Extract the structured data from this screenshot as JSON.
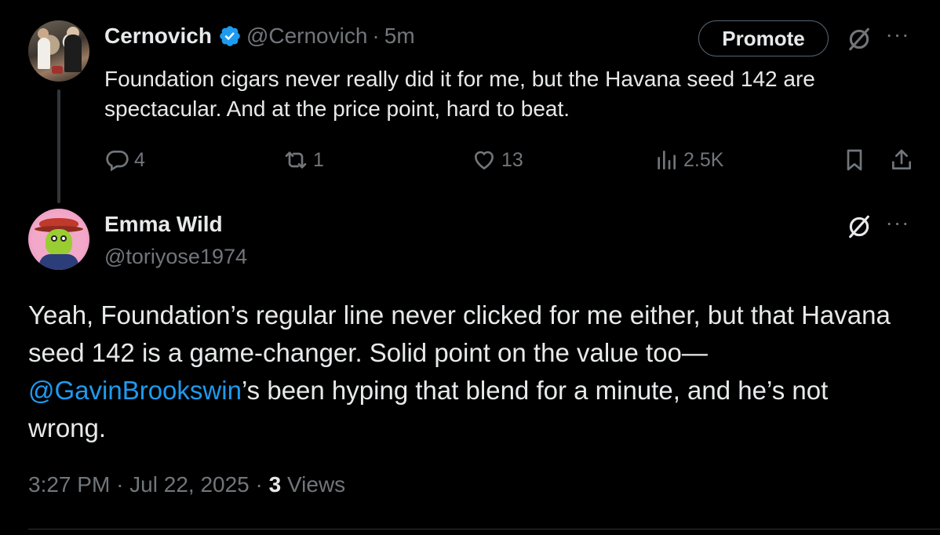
{
  "tweet1": {
    "display_name": "Cernovich",
    "handle": "@Cernovich",
    "separator": "·",
    "time": "5m",
    "verified_icon": "verified-badge-icon",
    "promote_label": "Promote",
    "text": "Foundation cigars never really did it for me, but the Havana seed 142 are spectacular. And at the price point, hard to beat.",
    "actions": {
      "replies": "4",
      "reposts": "1",
      "likes": "13",
      "views": "2.5K"
    }
  },
  "tweet2": {
    "display_name": "Emma Wild",
    "handle": "@toriyose1974",
    "text_before_mention": "Yeah, Foundation’s regular line never clicked for me either, but that Havana seed 142 is a game-changer. Solid point on the value too—",
    "mention": "@GavinBrookswin",
    "text_after_mention": "’s been hyping that blend for a minute, and he’s not wrong.",
    "meta": {
      "time": "3:27 PM",
      "separator": "·",
      "date": "Jul 22, 2025",
      "views_count": "3",
      "views_label": "Views"
    }
  },
  "colors": {
    "background": "#000000",
    "text_primary": "#e7e9ea",
    "text_secondary": "#71767b",
    "link_blue": "#1d9bf0",
    "verified_blue": "#1d9bf0"
  }
}
